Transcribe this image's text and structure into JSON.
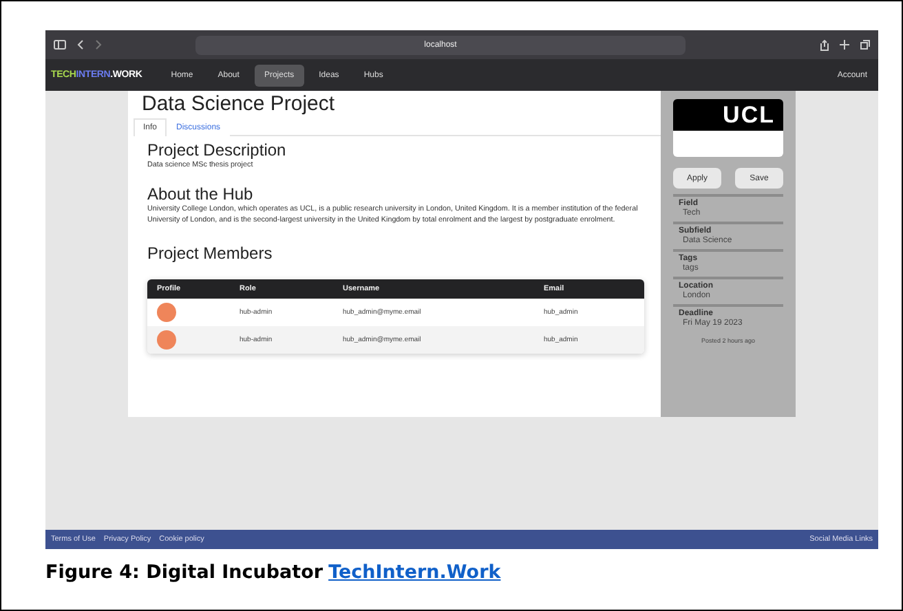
{
  "browser": {
    "address": "localhost"
  },
  "logo": [
    {
      "text": "TECH",
      "color": "#a8d84e"
    },
    {
      "text": "INTERN",
      "color": "#6b7cf0"
    },
    {
      "text": ".WORK",
      "color": "#ffffff"
    }
  ],
  "nav": [
    {
      "label": "Home",
      "selected": false
    },
    {
      "label": "About",
      "selected": false
    },
    {
      "label": "Projects",
      "selected": true
    },
    {
      "label": "Ideas",
      "selected": false
    },
    {
      "label": "Hubs",
      "selected": false
    }
  ],
  "account": "Account",
  "title": "Data Science Project",
  "tabs": [
    {
      "label": "Info",
      "selected": true
    },
    {
      "label": "Discussions",
      "selected": false
    }
  ],
  "sections": [
    {
      "heading": "Project Description",
      "text": "Data science MSc thesis project"
    },
    {
      "heading": "About the Hub",
      "text": "University College London, which operates as UCL, is a public research university in London, United Kingdom. It is a member institution of the federal University of London, and is the second-largest university in the United Kingdom by total enrolment and the largest by postgraduate enrolment."
    }
  ],
  "members": {
    "heading": "Project Members",
    "columns": [
      "Profile",
      "Role",
      "Username",
      "Email"
    ],
    "rows": [
      {
        "role": "hub-admin",
        "username": "hub_admin@myme.email",
        "email": "hub_admin"
      },
      {
        "role": "hub-admin",
        "username": "hub_admin@myme.email",
        "email": "hub_admin"
      }
    ]
  },
  "sidebar": {
    "logo_text": "UCL",
    "buttons": [
      "Apply",
      "Save"
    ],
    "fields": [
      {
        "label": "Field",
        "value": "Tech"
      },
      {
        "label": "Subfield",
        "value": "Data Science"
      },
      {
        "label": "Tags",
        "value": "tags"
      },
      {
        "label": "Location",
        "value": "London"
      },
      {
        "label": "Deadline",
        "value": "Fri May 19 2023"
      }
    ],
    "posted": "Posted 2 hours ago"
  },
  "footer": {
    "links": [
      "Terms of Use",
      "Privacy Policy",
      "Cookie policy"
    ],
    "right": "Social Media Links"
  },
  "caption": {
    "text": "Figure 4: Digital Incubator",
    "link": "TechIntern.Work"
  }
}
